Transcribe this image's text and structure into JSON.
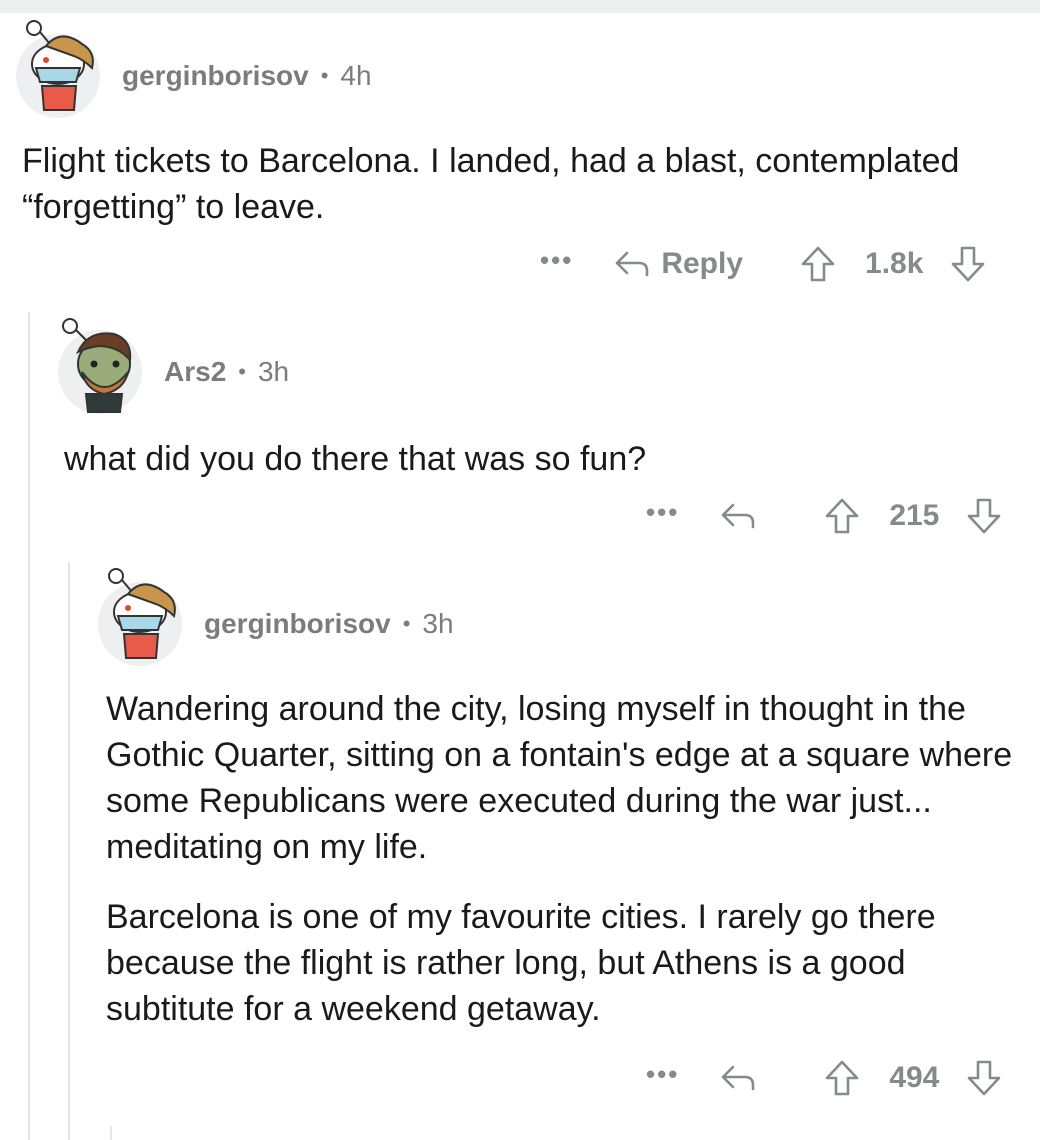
{
  "comments": [
    {
      "username": "gerginborisov",
      "separator": "•",
      "time": "4h",
      "paragraphs": [
        "Flight tickets to Barcelona. I landed, had a blast, contemplated “forgetting” to leave."
      ],
      "more": "•••",
      "reply_label": "Reply",
      "score": "1.8k"
    },
    {
      "username": "Ars2",
      "separator": "•",
      "time": "3h",
      "paragraphs": [
        "what did you do there that was so fun?"
      ],
      "more": "•••",
      "reply_label": "",
      "score": "215"
    },
    {
      "username": "gerginborisov",
      "separator": "•",
      "time": "3h",
      "paragraphs": [
        "Wandering around the city, losing myself in thought in the Gothic Quarter, sitting on a fontain's edge at a square where some Republicans were executed during the war just... meditating on my life.",
        "Barcelona is one of my favourite cities. I rarely go there because the flight is rather long, but Athens is a good subtitute for a weekend getaway."
      ],
      "more": "•••",
      "reply_label": "",
      "score": "494"
    }
  ],
  "colors": {
    "meta_text": "#7c7c7c",
    "body_text": "#1a1a1b",
    "action_text": "#878a8c",
    "thread_line": "#e3e5e8",
    "avatar_bg": "#edeff1"
  }
}
